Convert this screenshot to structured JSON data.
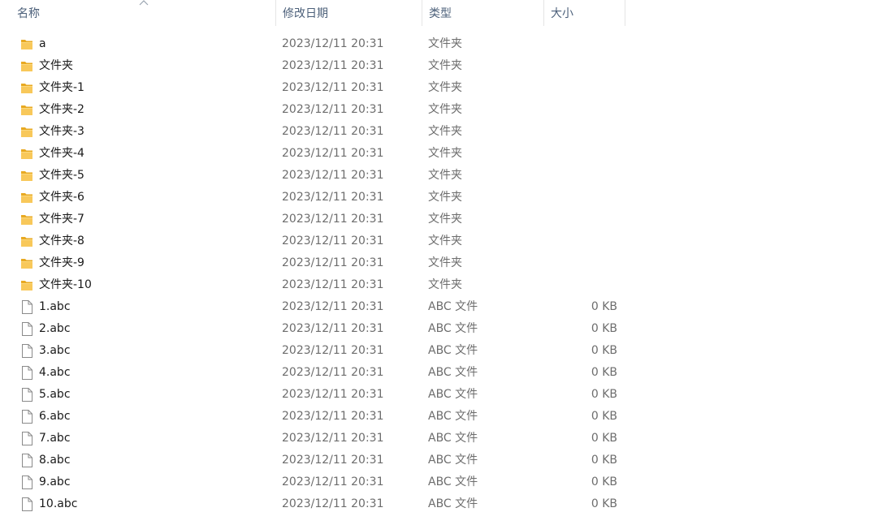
{
  "columns": {
    "name": "名称",
    "date": "修改日期",
    "type": "类型",
    "size": "大小"
  },
  "colors": {
    "header_text": "#4c607a",
    "folder": "#f5c04a",
    "meta_text": "#6d6d6d"
  },
  "items": [
    {
      "name": "a",
      "date": "2023/12/11 20:31",
      "type": "文件夹",
      "size": "",
      "icon": "folder-icon"
    },
    {
      "name": "文件夹",
      "date": "2023/12/11 20:31",
      "type": "文件夹",
      "size": "",
      "icon": "folder-icon"
    },
    {
      "name": "文件夹-1",
      "date": "2023/12/11 20:31",
      "type": "文件夹",
      "size": "",
      "icon": "folder-icon"
    },
    {
      "name": "文件夹-2",
      "date": "2023/12/11 20:31",
      "type": "文件夹",
      "size": "",
      "icon": "folder-icon"
    },
    {
      "name": "文件夹-3",
      "date": "2023/12/11 20:31",
      "type": "文件夹",
      "size": "",
      "icon": "folder-icon"
    },
    {
      "name": "文件夹-4",
      "date": "2023/12/11 20:31",
      "type": "文件夹",
      "size": "",
      "icon": "folder-icon"
    },
    {
      "name": "文件夹-5",
      "date": "2023/12/11 20:31",
      "type": "文件夹",
      "size": "",
      "icon": "folder-icon"
    },
    {
      "name": "文件夹-6",
      "date": "2023/12/11 20:31",
      "type": "文件夹",
      "size": "",
      "icon": "folder-icon"
    },
    {
      "name": "文件夹-7",
      "date": "2023/12/11 20:31",
      "type": "文件夹",
      "size": "",
      "icon": "folder-icon"
    },
    {
      "name": "文件夹-8",
      "date": "2023/12/11 20:31",
      "type": "文件夹",
      "size": "",
      "icon": "folder-icon"
    },
    {
      "name": "文件夹-9",
      "date": "2023/12/11 20:31",
      "type": "文件夹",
      "size": "",
      "icon": "folder-icon"
    },
    {
      "name": "文件夹-10",
      "date": "2023/12/11 20:31",
      "type": "文件夹",
      "size": "",
      "icon": "folder-icon"
    },
    {
      "name": "1.abc",
      "date": "2023/12/11 20:31",
      "type": "ABC 文件",
      "size": "0 KB",
      "icon": "file-icon"
    },
    {
      "name": "2.abc",
      "date": "2023/12/11 20:31",
      "type": "ABC 文件",
      "size": "0 KB",
      "icon": "file-icon"
    },
    {
      "name": "3.abc",
      "date": "2023/12/11 20:31",
      "type": "ABC 文件",
      "size": "0 KB",
      "icon": "file-icon"
    },
    {
      "name": "4.abc",
      "date": "2023/12/11 20:31",
      "type": "ABC 文件",
      "size": "0 KB",
      "icon": "file-icon"
    },
    {
      "name": "5.abc",
      "date": "2023/12/11 20:31",
      "type": "ABC 文件",
      "size": "0 KB",
      "icon": "file-icon"
    },
    {
      "name": "6.abc",
      "date": "2023/12/11 20:31",
      "type": "ABC 文件",
      "size": "0 KB",
      "icon": "file-icon"
    },
    {
      "name": "7.abc",
      "date": "2023/12/11 20:31",
      "type": "ABC 文件",
      "size": "0 KB",
      "icon": "file-icon"
    },
    {
      "name": "8.abc",
      "date": "2023/12/11 20:31",
      "type": "ABC 文件",
      "size": "0 KB",
      "icon": "file-icon"
    },
    {
      "name": "9.abc",
      "date": "2023/12/11 20:31",
      "type": "ABC 文件",
      "size": "0 KB",
      "icon": "file-icon"
    },
    {
      "name": "10.abc",
      "date": "2023/12/11 20:31",
      "type": "ABC 文件",
      "size": "0 KB",
      "icon": "file-icon"
    }
  ]
}
